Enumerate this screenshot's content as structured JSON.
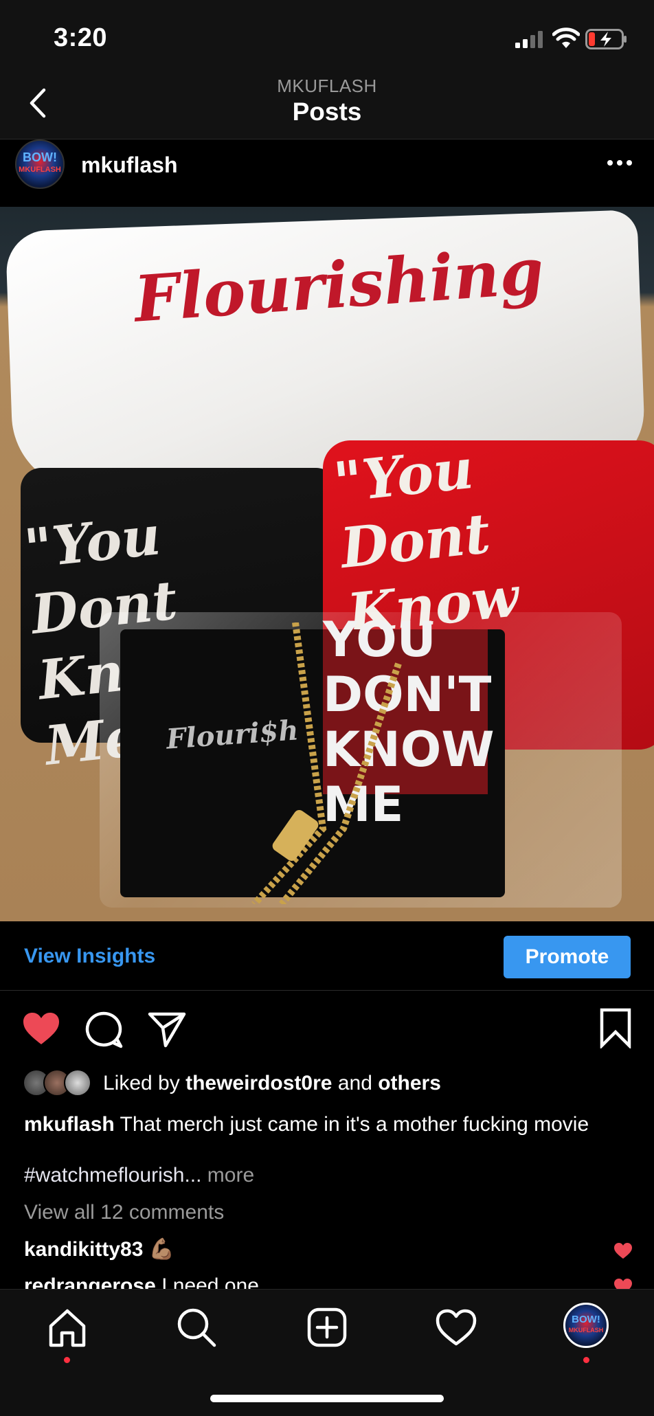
{
  "status": {
    "time": "3:20"
  },
  "nav": {
    "account": "MKUFLASH",
    "title": "Posts"
  },
  "post": {
    "username": "mkuflash",
    "avatar_text": "BOW! MKUFLASH",
    "image_text": {
      "white_shirt": "Flourishing",
      "black_shirt": "\"You Dont Know Me\"",
      "red_shirt": "\"You Dont Know Me\"",
      "package_text": "YOU DON'T KNOW ME",
      "package_brand": "Flouri$h"
    },
    "insights_label": "View Insights",
    "promote_label": "Promote",
    "likes": {
      "prefix": "Liked by ",
      "user": "theweirdost0re",
      "middle": " and ",
      "others": "others"
    },
    "caption_user": "mkuflash",
    "caption_text": " That merch just came in it's a mother fucking movie",
    "hashtag": "#watchmeflourish...",
    "more_label": " more",
    "view_comments": "View all 12 comments",
    "comments": [
      {
        "user": "kandikitty83",
        "text": " 💪🏽"
      },
      {
        "user": "redrangerose",
        "text": " I need one"
      }
    ]
  },
  "icons": {
    "like": "heart-filled-icon",
    "comment": "comment-icon",
    "share": "send-icon",
    "save": "bookmark-icon",
    "home": "home-icon",
    "search": "search-icon",
    "create": "plus-square-icon",
    "activity": "heart-outline-icon",
    "profile": "profile-avatar"
  },
  "colors": {
    "accent": "#3897f0",
    "like": "#ed4956",
    "background": "#000000"
  }
}
